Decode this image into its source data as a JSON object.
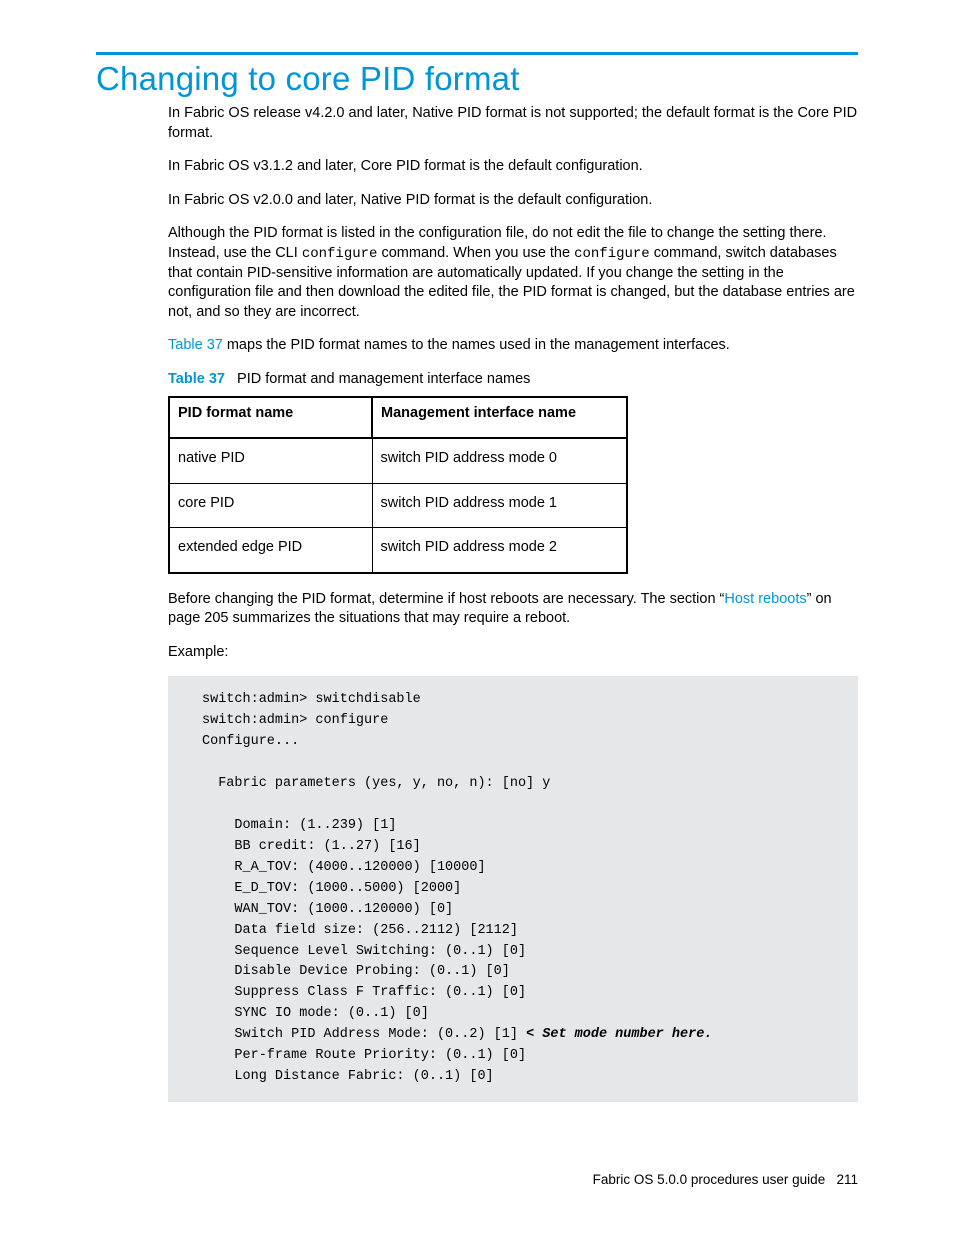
{
  "heading": "Changing to core PID format",
  "paragraphs": {
    "p1": "In Fabric OS release v4.2.0 and later, Native PID format is not supported; the default format is the Core PID format.",
    "p2": "In Fabric OS v3.1.2 and later, Core PID format is the default configuration.",
    "p3": "In Fabric OS v2.0.0 and later, Native PID format is the default configuration.",
    "p4a": "Although the PID format is listed in the configuration file, do not edit the file to change the setting there. Instead, use the CLI ",
    "p4_cmd1": "configure",
    "p4b": " command. When you use the ",
    "p4_cmd2": "configure",
    "p4c": " command, switch databases that contain PID-sensitive information are automatically updated. If you change the setting in the configuration file and then download the edited file, the PID format is changed, but the database entries are not, and so they are incorrect.",
    "p5_link": "Table 37",
    "p5_rest": " maps the PID format names to the names used in the management interfaces.",
    "p6a": "Before changing the PID format, determine if host reboots are necessary. The section “",
    "p6_link": "Host reboots",
    "p6b": "” on page 205 summarizes the situations that may require a reboot.",
    "example_label": "Example:"
  },
  "table": {
    "caption_label": "Table 37",
    "caption_text": "PID format and management interface names",
    "headers": [
      "PID format name",
      "Management interface name"
    ],
    "rows": [
      [
        "native PID",
        "switch PID address mode 0"
      ],
      [
        "core PID",
        "switch PID address mode 1"
      ],
      [
        "extended edge PID",
        "switch PID address mode 2"
      ]
    ]
  },
  "code": {
    "l1": "switch:admin> switchdisable",
    "l2": "switch:admin> configure",
    "l3": "Configure...",
    "l4": "  Fabric parameters (yes, y, no, n): [no] y",
    "l5": "    Domain: (1..239) [1]",
    "l6": "    BB credit: (1..27) [16]",
    "l7": "    R_A_TOV: (4000..120000) [10000]",
    "l8": "    E_D_TOV: (1000..5000) [2000]",
    "l9": "    WAN_TOV: (1000..120000) [0]",
    "l10": "    Data field size: (256..2112) [2112]",
    "l11": "    Sequence Level Switching: (0..1) [0]",
    "l12": "    Disable Device Probing: (0..1) [0]",
    "l13": "    Suppress Class F Traffic: (0..1) [0]",
    "l14": "    SYNC IO mode: (0..1) [0]",
    "l15a": "    Switch PID Address Mode: (0..2) [1] ",
    "l15b": "< Set mode number here.",
    "l16": "    Per-frame Route Priority: (0..1) [0]",
    "l17": "    Long Distance Fabric: (0..1) [0]"
  },
  "footer": {
    "doc_title": "Fabric OS 5.0.0 procedures user guide",
    "page_num": "211"
  }
}
